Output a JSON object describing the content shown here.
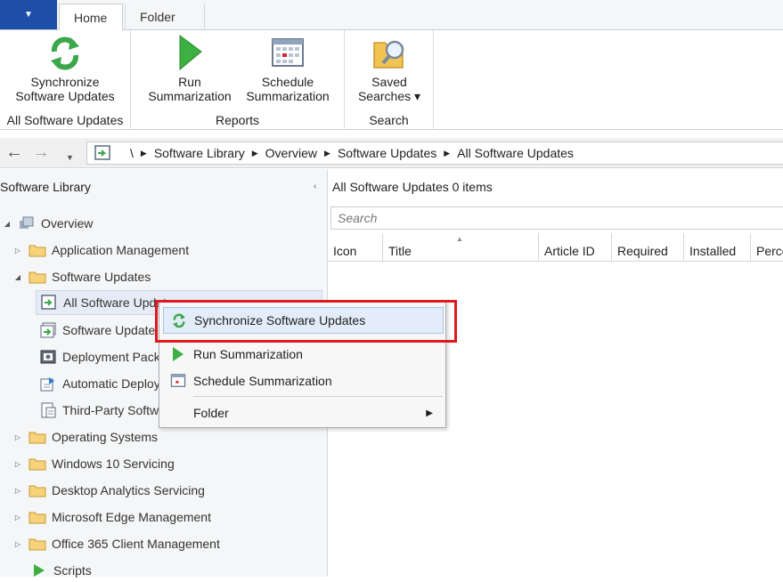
{
  "ribbon": {
    "app_menu_glyph": "▼",
    "tabs": [
      {
        "label": "Home"
      },
      {
        "label": "Folder"
      }
    ],
    "groups": [
      {
        "buttons": [
          {
            "label_line1": "Synchronize",
            "label_line2": "Software Updates"
          }
        ],
        "label": "All Software Updates"
      },
      {
        "buttons": [
          {
            "label_line1": "Run",
            "label_line2": "Summarization"
          },
          {
            "label_line1": "Schedule",
            "label_line2": "Summarization"
          }
        ],
        "label": "Reports"
      },
      {
        "buttons": [
          {
            "label_line1": "Saved",
            "label_line2": "Searches ▾"
          }
        ],
        "label": "Search"
      }
    ]
  },
  "address": {
    "root": "\\",
    "crumbs": [
      "Software Library",
      "Overview",
      "Software Updates",
      "All Software Updates"
    ]
  },
  "nav": {
    "title": "Software Library",
    "collapse_glyph": "‹",
    "items": [
      {
        "label": "Overview",
        "icon": "overview-icon"
      },
      {
        "label": "Application Management",
        "icon": "folder-icon"
      },
      {
        "label": "Software Updates",
        "icon": "folder-icon"
      },
      {
        "label": "All Software Updates",
        "icon": "software-updates-icon"
      },
      {
        "label": "Software Update Groups",
        "icon": "software-update-groups-icon"
      },
      {
        "label": "Deployment Packages",
        "icon": "deployment-packages-icon"
      },
      {
        "label": "Automatic Deployment Rules",
        "icon": "adr-icon"
      },
      {
        "label": "Third-Party Software Update Catalogs",
        "icon": "catalog-icon"
      },
      {
        "label": "Operating Systems",
        "icon": "folder-icon"
      },
      {
        "label": "Windows 10 Servicing",
        "icon": "folder-icon"
      },
      {
        "label": "Desktop Analytics Servicing",
        "icon": "folder-icon"
      },
      {
        "label": "Microsoft Edge Management",
        "icon": "folder-icon"
      },
      {
        "label": "Office 365 Client Management",
        "icon": "folder-icon"
      },
      {
        "label": "Scripts",
        "icon": "scripts-icon"
      }
    ]
  },
  "content": {
    "title": "All Software Updates",
    "count": "0 items",
    "search_placeholder": "Search",
    "columns": [
      "Icon",
      "Title",
      "Article ID",
      "Required",
      "Installed",
      "Perce"
    ]
  },
  "context_menu": {
    "items": [
      {
        "label": "Synchronize Software Updates",
        "icon": "sync-icon",
        "highlighted": true
      },
      {
        "label": "Run Summarization",
        "icon": "run-icon"
      },
      {
        "label": "Schedule Summarization",
        "icon": "calendar-icon"
      },
      {
        "label": "Folder",
        "icon": "",
        "submenu": true
      }
    ],
    "submenu_glyph": "▶"
  },
  "colors": {
    "accent": "#1d4fa8",
    "highlight_border": "#e0191f",
    "sync_green": "#3aa84a"
  }
}
